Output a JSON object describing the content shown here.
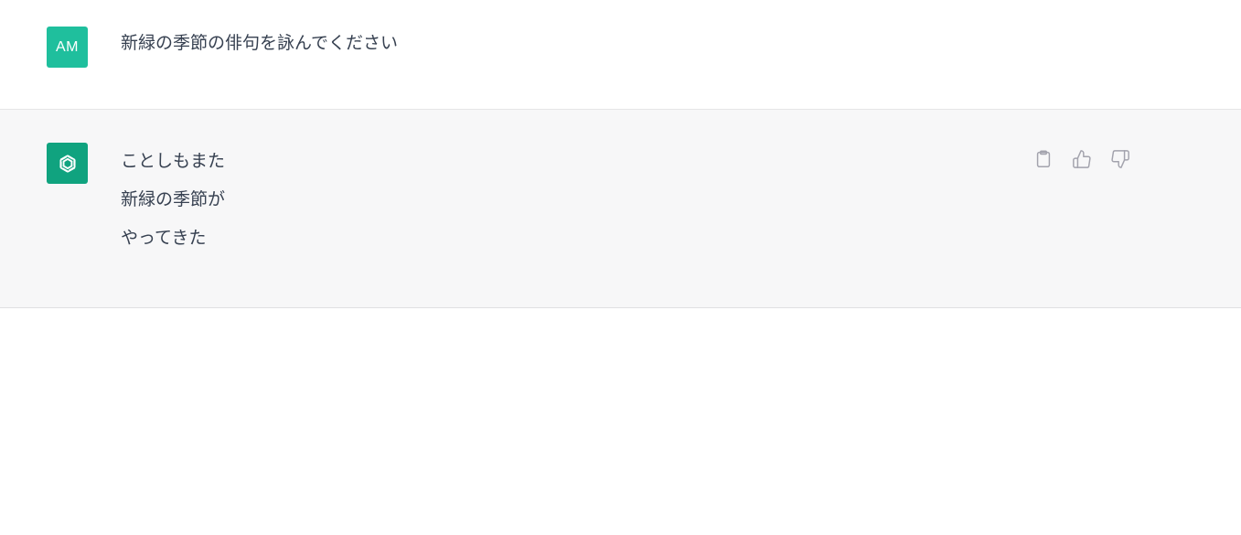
{
  "user_message": {
    "avatar_initials": "AM",
    "text": "新緑の季節の俳句を詠んでください"
  },
  "assistant_message": {
    "avatar_icon": "openai-logo-icon",
    "lines": [
      "ことしもまた",
      "新緑の季節が",
      "やってきた"
    ],
    "actions": [
      {
        "icon": "clipboard-icon"
      },
      {
        "icon": "thumbs-up-icon"
      },
      {
        "icon": "thumbs-down-icon"
      }
    ]
  },
  "colors": {
    "user_avatar_bg": "#1fbf9d",
    "assistant_avatar_bg": "#10a37f",
    "assistant_row_bg": "#f7f7f8",
    "text": "#374151",
    "icon": "#a3a3ad"
  }
}
